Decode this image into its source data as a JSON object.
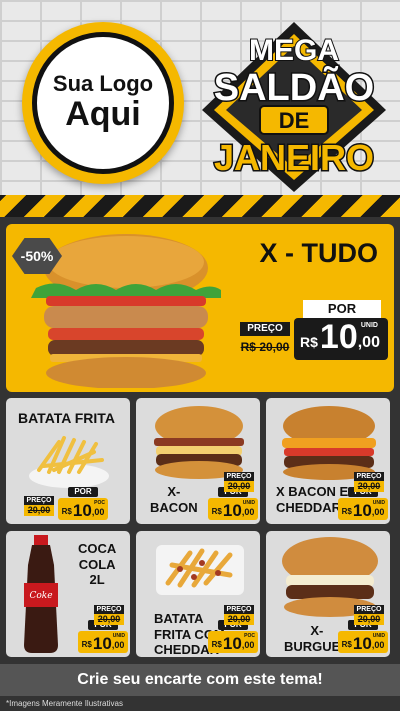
{
  "logo": {
    "line1": "Sua Logo",
    "line2": "Aqui"
  },
  "headline": {
    "line1": "MEGA",
    "line2": "SALDÃO",
    "line3": "DE",
    "line4": "JANEIRO"
  },
  "hero": {
    "title": "X - TUDO",
    "discount": "-50%",
    "por": "POR",
    "preco": "PREÇO",
    "old_price": "R$ 20,00",
    "currency": "R$",
    "price_int": "10",
    "price_dec": ",00",
    "unit": "UNID"
  },
  "labels": {
    "preco": "PREÇO",
    "por": "POR",
    "currency": "R$",
    "unid": "UNID",
    "poc": "POC"
  },
  "products": [
    {
      "name": "BATATA FRITA",
      "old_price": "20,00",
      "price_int": "10",
      "price_dec": ",00",
      "unit": "POC"
    },
    {
      "name": "X-\nBACON",
      "old_price": "20,00",
      "price_int": "10",
      "price_dec": ",00",
      "unit": "UNID"
    },
    {
      "name": "X BACON E\nCHEDDAR",
      "old_price": "20,00",
      "price_int": "10",
      "price_dec": ",00",
      "unit": "UNID"
    },
    {
      "name": "COCA\nCOLA\n2L",
      "old_price": "20,00",
      "price_int": "10",
      "price_dec": ",00",
      "unit": "UNID"
    },
    {
      "name": "BATATA\nFRITA COM\nCHEDDAR",
      "old_price": "20,00",
      "price_int": "10",
      "price_dec": ",00",
      "unit": "POC"
    },
    {
      "name": "X-\nBURGUER",
      "old_price": "20,00",
      "price_int": "10",
      "price_dec": ",00",
      "unit": "UNID"
    }
  ],
  "cta": "Crie seu encarte com este tema!",
  "footer": "*Imagens Meramente Ilustrativas",
  "colors": {
    "accent": "#f5b800",
    "dark": "#1a1a1a",
    "card": "#dcdcdc"
  }
}
